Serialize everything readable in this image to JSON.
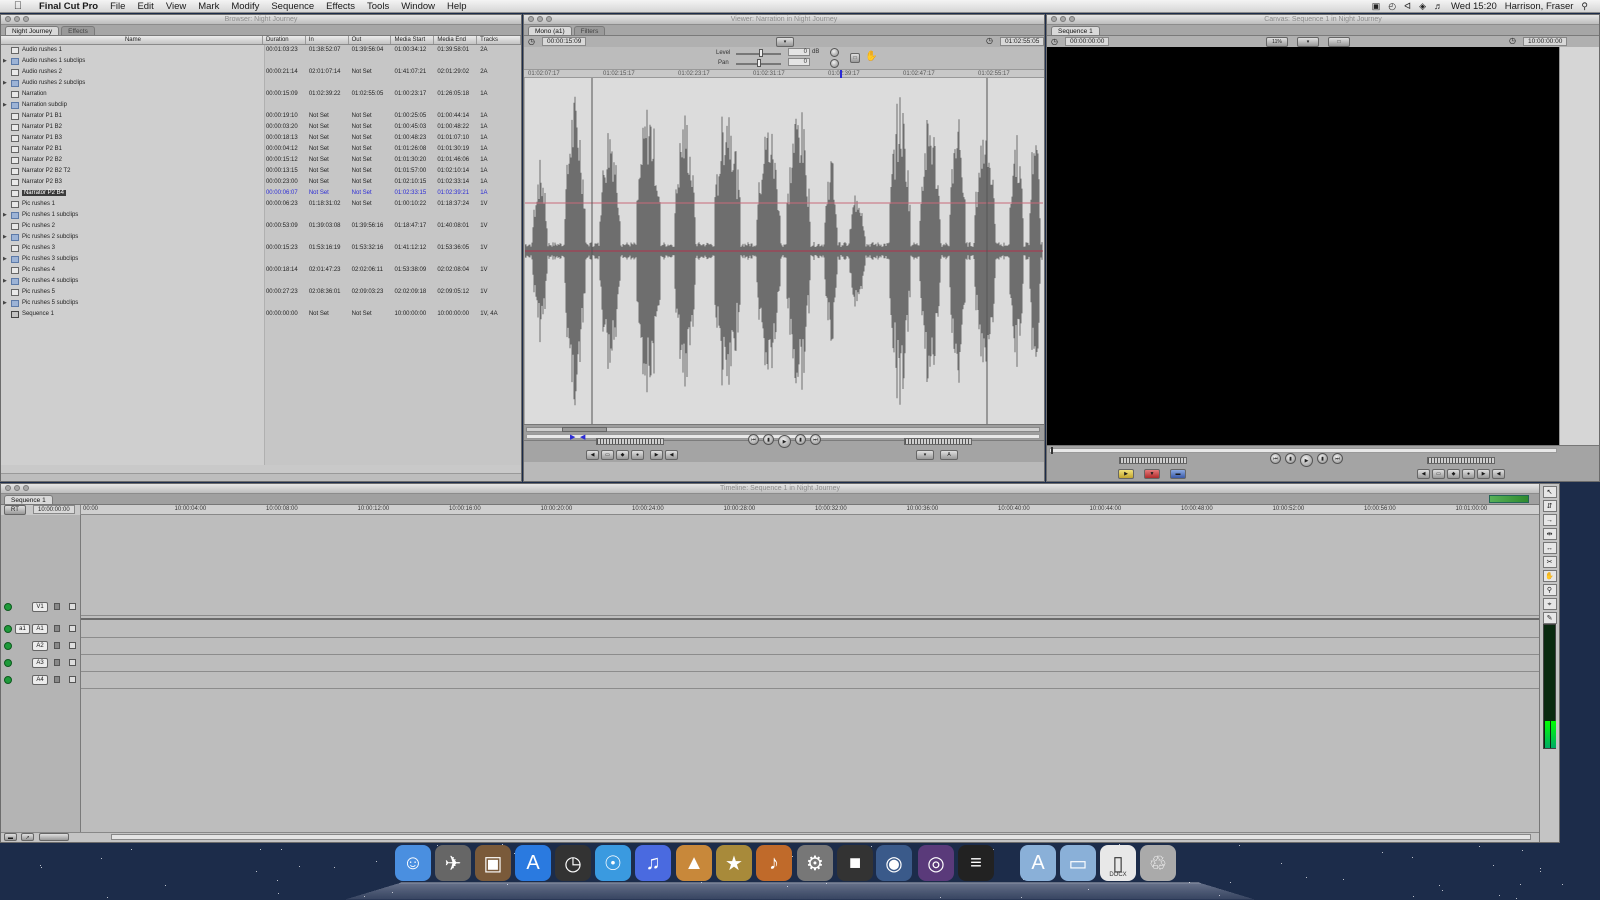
{
  "menubar": {
    "app": "Final Cut Pro",
    "items": [
      "File",
      "Edit",
      "View",
      "Mark",
      "Modify",
      "Sequence",
      "Effects",
      "Tools",
      "Window",
      "Help"
    ],
    "clock": "Wed 15:20",
    "user": "Harrison, Fraser"
  },
  "browser": {
    "title": "Browser: Night Journey",
    "tabs": [
      "Night Journey",
      "Effects"
    ],
    "columns": [
      "Name",
      "Duration",
      "In",
      "Out",
      "Media Start",
      "Media End",
      "Tracks"
    ],
    "rows": [
      {
        "name": "Audio rushes 1",
        "type": "clip",
        "duration": "00:01:03:23",
        "in": "01:38:52:07",
        "out": "01:39:56:04",
        "mstart": "01:00:34:12",
        "mend": "01:39:58:01",
        "tracks": "2A"
      },
      {
        "name": "Audio rushes 1 subclips",
        "type": "bin",
        "duration": "",
        "in": "",
        "out": "",
        "mstart": "",
        "mend": "",
        "tracks": ""
      },
      {
        "name": "Audio rushes 2",
        "type": "clip",
        "duration": "00:00:21:14",
        "in": "02:01:07:14",
        "out": "Not Set",
        "mstart": "01:41:07:21",
        "mend": "02:01:29:02",
        "tracks": "2A"
      },
      {
        "name": "Audio rushes 2 subclips",
        "type": "bin",
        "duration": "",
        "in": "",
        "out": "",
        "mstart": "",
        "mend": "",
        "tracks": ""
      },
      {
        "name": "Narration",
        "type": "clip",
        "duration": "00:00:15:09",
        "in": "01:02:39:22",
        "out": "01:02:55:05",
        "mstart": "01:00:23:17",
        "mend": "01:26:05:18",
        "tracks": "1A"
      },
      {
        "name": "Narration subclip",
        "type": "bin",
        "duration": "",
        "in": "",
        "out": "",
        "mstart": "",
        "mend": "",
        "tracks": ""
      },
      {
        "name": "Narrator P1 B1",
        "type": "clip",
        "duration": "00:00:19:10",
        "in": "Not Set",
        "out": "Not Set",
        "mstart": "01:00:25:05",
        "mend": "01:00:44:14",
        "tracks": "1A"
      },
      {
        "name": "Narrator P1 B2",
        "type": "clip",
        "duration": "00:00:03:20",
        "in": "Not Set",
        "out": "Not Set",
        "mstart": "01:00:45:03",
        "mend": "01:00:48:22",
        "tracks": "1A"
      },
      {
        "name": "Narrator P1 B3",
        "type": "clip",
        "duration": "00:00:18:13",
        "in": "Not Set",
        "out": "Not Set",
        "mstart": "01:00:48:23",
        "mend": "01:01:07:10",
        "tracks": "1A"
      },
      {
        "name": "Narrator P2 B1",
        "type": "clip",
        "duration": "00:00:04:12",
        "in": "Not Set",
        "out": "Not Set",
        "mstart": "01:01:26:08",
        "mend": "01:01:30:19",
        "tracks": "1A"
      },
      {
        "name": "Narrator P2 B2",
        "type": "clip",
        "duration": "00:00:15:12",
        "in": "Not Set",
        "out": "Not Set",
        "mstart": "01:01:30:20",
        "mend": "01:01:46:06",
        "tracks": "1A"
      },
      {
        "name": "Narrator P2 B2 T2",
        "type": "clip",
        "duration": "00:00:13:15",
        "in": "Not Set",
        "out": "Not Set",
        "mstart": "01:01:57:00",
        "mend": "01:02:10:14",
        "tracks": "1A"
      },
      {
        "name": "Narrator P2 B3",
        "type": "clip",
        "duration": "00:00:23:00",
        "in": "Not Set",
        "out": "Not Set",
        "mstart": "01:02:10:15",
        "mend": "01:02:33:14",
        "tracks": "1A"
      },
      {
        "name": "Narrator P2 B4",
        "type": "clip",
        "selected": true,
        "duration": "00:00:06:07",
        "in": "Not Set",
        "out": "Not Set",
        "mstart": "01:02:33:15",
        "mend": "01:02:39:21",
        "tracks": "1A"
      },
      {
        "name": "Pic rushes 1",
        "type": "clip",
        "duration": "00:00:06:23",
        "in": "01:18:31:02",
        "out": "Not Set",
        "mstart": "01:00:10:22",
        "mend": "01:18:37:24",
        "tracks": "1V"
      },
      {
        "name": "Pic rushes 1 subclips",
        "type": "bin",
        "duration": "",
        "in": "",
        "out": "",
        "mstart": "",
        "mend": "",
        "tracks": ""
      },
      {
        "name": "Pic rushes 2",
        "type": "clip",
        "duration": "00:00:53:09",
        "in": "01:39:03:08",
        "out": "01:39:56:16",
        "mstart": "01:18:47:17",
        "mend": "01:40:08:01",
        "tracks": "1V"
      },
      {
        "name": "Pic rushes 2 subclips",
        "type": "bin",
        "duration": "",
        "in": "",
        "out": "",
        "mstart": "",
        "mend": "",
        "tracks": ""
      },
      {
        "name": "Pic rushes 3",
        "type": "clip",
        "duration": "00:00:15:23",
        "in": "01:53:16:19",
        "out": "01:53:32:16",
        "mstart": "01:41:12:12",
        "mend": "01:53:36:05",
        "tracks": "1V"
      },
      {
        "name": "Pic rushes 3 subclips",
        "type": "bin",
        "duration": "",
        "in": "",
        "out": "",
        "mstart": "",
        "mend": "",
        "tracks": ""
      },
      {
        "name": "Pic rushes 4",
        "type": "clip",
        "duration": "00:00:18:14",
        "in": "02:01:47:23",
        "out": "02:02:06:11",
        "mstart": "01:53:38:09",
        "mend": "02:02:08:04",
        "tracks": "1V"
      },
      {
        "name": "Pic rushes 4 subclips",
        "type": "bin",
        "duration": "",
        "in": "",
        "out": "",
        "mstart": "",
        "mend": "",
        "tracks": ""
      },
      {
        "name": "Pic rushes 5",
        "type": "clip",
        "duration": "00:00:27:23",
        "in": "02:08:36:01",
        "out": "02:09:03:23",
        "mstart": "02:02:09:18",
        "mend": "02:09:05:12",
        "tracks": "1V"
      },
      {
        "name": "Pic rushes 5 subclips",
        "type": "bin",
        "duration": "",
        "in": "",
        "out": "",
        "mstart": "",
        "mend": "",
        "tracks": ""
      },
      {
        "name": "Sequence 1",
        "type": "seq",
        "duration": "00:00:00:00",
        "in": "Not Set",
        "out": "Not Set",
        "mstart": "10:00:00:00",
        "mend": "10:00:00:00",
        "tracks": "1V, 4A"
      }
    ]
  },
  "viewer": {
    "title": "Viewer: Narration in Night Journey",
    "tabs": [
      "Mono (a1)",
      "Filters"
    ],
    "timecode_duration": "00:00:15:09",
    "timecode_current": "01:02:55:05",
    "level_label": "Level",
    "pan_label": "Pan",
    "level_value": "0",
    "pan_value": "0",
    "level_unit": "dB",
    "ruler_marks": [
      "01:02:07:17",
      "01:02:15:17",
      "01:02:23:17",
      "01:02:31:17",
      "01:02:39:17",
      "01:02:47:17",
      "01:02:55:17"
    ]
  },
  "canvas": {
    "title": "Canvas: Sequence 1 in Night Journey",
    "tabs": [
      "Sequence 1"
    ],
    "timecode_duration": "00:00:00:00",
    "timecode_current": "10:00:00:00",
    "zoom": "11%"
  },
  "timeline": {
    "title": "Timeline: Sequence 1 in Night Journey",
    "tabs": [
      "Sequence 1"
    ],
    "rt_label": "RT",
    "current_timecode": "10:00:00:00",
    "ruler_marks": [
      "00:00",
      "10:00:04:00",
      "10:00:08:00",
      "10:00:12:00",
      "10:00:16:00",
      "10:00:20:00",
      "10:00:24:00",
      "10:00:28:00",
      "10:00:32:00",
      "10:00:36:00",
      "10:00:40:00",
      "10:00:44:00",
      "10:00:48:00",
      "10:00:52:00",
      "10:00:56:00",
      "10:01:00:00"
    ],
    "tracks": [
      {
        "label": "V1",
        "source": ""
      },
      {
        "label": "A1",
        "source": "a1"
      },
      {
        "label": "A2",
        "source": ""
      },
      {
        "label": "A3",
        "source": ""
      },
      {
        "label": "A4",
        "source": ""
      }
    ]
  },
  "dock": {
    "items": [
      "finder-icon",
      "launchpad-icon",
      "photo-browser-icon",
      "app-store-icon",
      "dashboard-icon",
      "safari-icon",
      "itunes-icon",
      "iphoto-icon",
      "imovie-icon",
      "garageband-icon",
      "system-preferences-icon",
      "photo-booth-icon",
      "facetime-icon",
      "dvd-player-icon",
      "final-cut-pro-icon",
      "applications-folder-icon",
      "documents-folder-icon",
      "downloads-folder-icon",
      "trash-icon"
    ],
    "docs_label": "DOCX"
  },
  "colors": {
    "desktop": "#1c2c4a",
    "selection": "#2b2bd6",
    "track_enabled": "#1e9a3a",
    "waveform": "#6e6e6e"
  }
}
